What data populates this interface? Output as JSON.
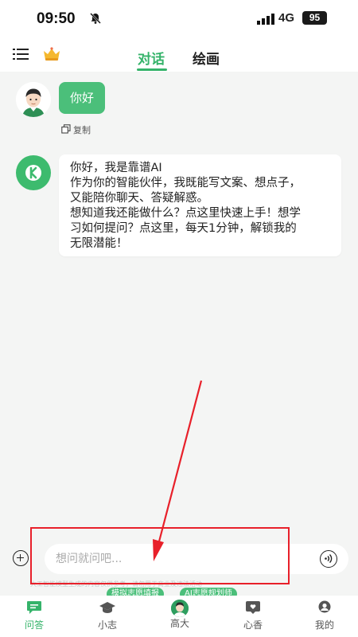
{
  "status": {
    "time": "09:50",
    "network": "4G",
    "battery": "95"
  },
  "nav": {
    "tab_chat": "对话",
    "tab_draw": "绘画"
  },
  "chat": {
    "user_message": "你好",
    "copy_label": "复制",
    "bot_lines": [
      "你好，我是靠谱AI",
      "作为你的智能伙伴，我既能写文案、想点子，",
      "又能陪你聊天、答疑解惑。",
      "想知道我还能做什么？点这里快速上手！想学",
      "习如何提问？点这里，每天1分钟，解锁我的",
      "无限潜能！"
    ]
  },
  "input": {
    "placeholder": "想问就问吧...",
    "disclaimer": "大工智能模型生成的内容仅供参考，请勿用于商业及违法活动"
  },
  "tabbar": {
    "items": [
      {
        "label": "问答",
        "icon": "chat-icon"
      },
      {
        "label": "小志",
        "icon": "graduation-cap-icon"
      },
      {
        "label": "高大",
        "icon": "avatar-icon"
      },
      {
        "label": "心香",
        "icon": "heart-card-icon"
      },
      {
        "label": "我的",
        "icon": "person-icon"
      }
    ],
    "pill_left": "模拟志愿填报",
    "pill_right": "AI志愿规划师"
  },
  "colors": {
    "accent": "#35b36a",
    "bubble": "#4bbf7a",
    "annotation": "#e8202a"
  }
}
